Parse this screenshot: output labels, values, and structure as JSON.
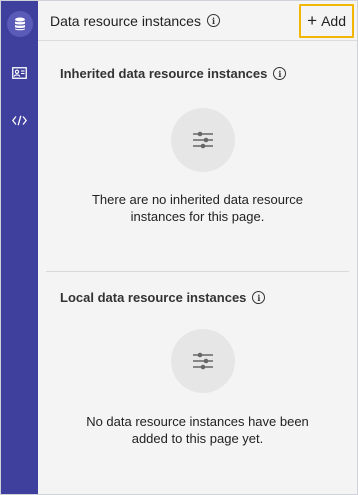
{
  "rail": {
    "items": [
      {
        "name": "data-resources",
        "icon": "database-icon",
        "active": true
      },
      {
        "name": "properties",
        "icon": "contact-card-icon",
        "active": false
      },
      {
        "name": "code",
        "icon": "code-icon",
        "active": false
      }
    ]
  },
  "header": {
    "title": "Data resource instances",
    "add_label": "Add"
  },
  "inherited": {
    "title": "Inherited data resource instances",
    "empty_message": "There are no inherited data resource instances for this page.",
    "icon": "sliders-icon"
  },
  "local": {
    "title": "Local data resource instances",
    "empty_message": "No data resource instances have been added to this page yet.",
    "icon": "sliders-icon"
  },
  "colors": {
    "rail_background": "#3f3f9e",
    "focus_outline": "#f2b705",
    "panel_background": "#f4f4f4"
  }
}
